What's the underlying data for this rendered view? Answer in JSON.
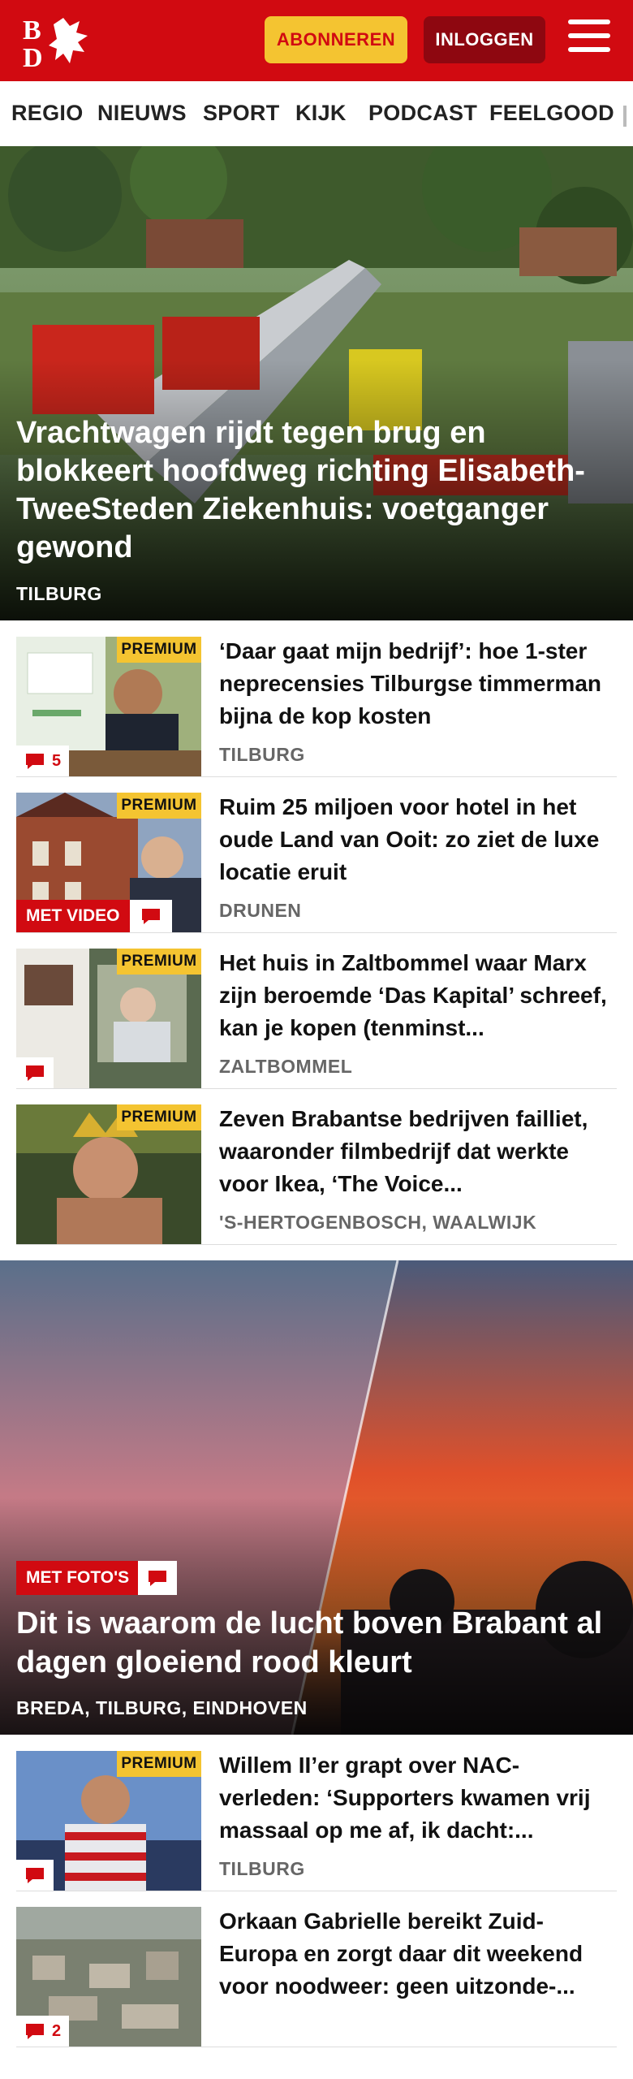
{
  "header": {
    "logo_text": "BD",
    "subscribe_label": "ABONNEREN",
    "login_label": "INLOGGEN",
    "brand_color": "#d10a11",
    "accent_color": "#f4c431"
  },
  "nav": {
    "items": [
      {
        "label": "REGIO"
      },
      {
        "label": "NIEUWS"
      },
      {
        "label": "SPORT"
      },
      {
        "label": "KIJK"
      },
      {
        "label": "PODCAST"
      },
      {
        "label": "FEELGOOD"
      }
    ]
  },
  "hero": {
    "title": "Vrachtwagen rijdt tegen brug en blokkeert hoofdweg richting Elisabeth-TweeSteden Ziekenhuis: voetganger gewond",
    "location": "TILBURG"
  },
  "articles": [
    {
      "badge": "PREMIUM",
      "title": "‘Daar gaat mijn bedrijf’: hoe 1-ster neprecensies Tilburgse timmerman bijna de kop kosten",
      "location": "TILBURG",
      "comments": "5"
    },
    {
      "badge": "PREMIUM",
      "video_label": "MET VIDEO",
      "title": "Ruim 25 miljoen voor hotel in het oude Land van Ooit: zo ziet de luxe locatie eruit",
      "location": "DRUNEN"
    },
    {
      "badge": "PREMIUM",
      "title": "Het huis in Zaltbommel waar Marx zijn beroemde ‘Das Kapital’ schreef, kan je kopen (tenminst...",
      "location": "ZALTBOMMEL"
    },
    {
      "badge": "PREMIUM",
      "title": "Zeven Brabantse bedrijven failliet, waaronder filmbedrijf dat werkte voor Ikea, ‘The Voice...",
      "location": "'S-HERTOGENBOSCH, WAALWIJK"
    }
  ],
  "hero2": {
    "media_label": "MET FOTO'S",
    "title": "Dit is waarom de lucht boven Brabant al dagen gloeiend rood kleurt",
    "location": "BREDA, TILBURG, EINDHOVEN"
  },
  "articles2": [
    {
      "badge": "PREMIUM",
      "title": "Willem II’er grapt over NAC-verleden: ‘Supporters kwamen vrij massaal op me af, ik dacht:...",
      "location": "TILBURG"
    },
    {
      "title": "Orkaan Gabrielle bereikt Zuid-Europa en zorgt daar dit weekend voor noodweer: geen uitzonde-...",
      "comments": "2"
    }
  ]
}
